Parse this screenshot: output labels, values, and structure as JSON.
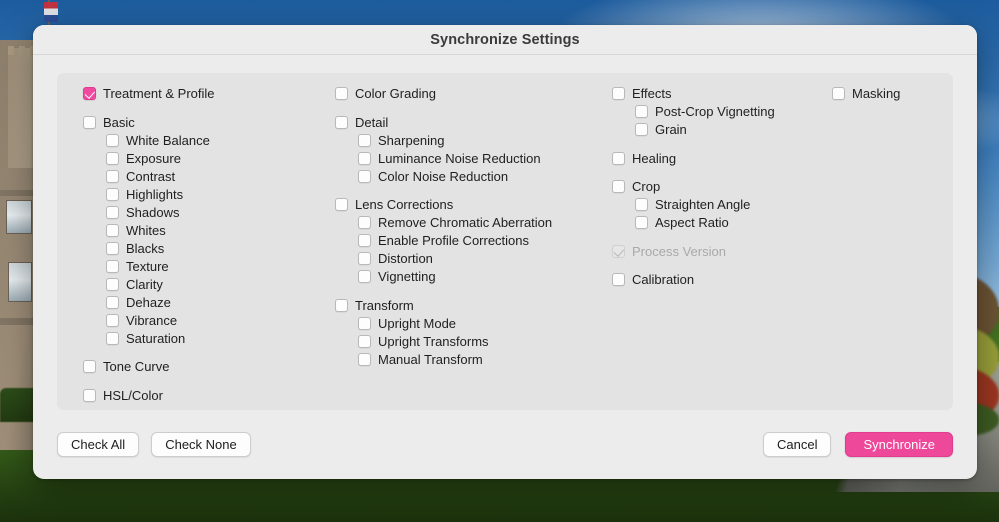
{
  "background": {
    "description": "castle-lawn-photo",
    "sky_color": "#3d80c0",
    "grass_color": "#4d7d26"
  },
  "dialog": {
    "title": "Synchronize Settings",
    "accent_color": "#ed4899"
  },
  "columns": [
    {
      "name": "column-1",
      "items": [
        {
          "label": "Treatment & Profile",
          "level": 0,
          "state": "checked",
          "gap": false
        },
        {
          "label": "Basic",
          "level": 0,
          "state": "unchecked",
          "gap": true
        },
        {
          "label": "White Balance",
          "level": 1,
          "state": "unchecked",
          "gap": false
        },
        {
          "label": "Exposure",
          "level": 1,
          "state": "unchecked",
          "gap": false
        },
        {
          "label": "Contrast",
          "level": 1,
          "state": "unchecked",
          "gap": false
        },
        {
          "label": "Highlights",
          "level": 1,
          "state": "unchecked",
          "gap": false
        },
        {
          "label": "Shadows",
          "level": 1,
          "state": "unchecked",
          "gap": false
        },
        {
          "label": "Whites",
          "level": 1,
          "state": "unchecked",
          "gap": false
        },
        {
          "label": "Blacks",
          "level": 1,
          "state": "unchecked",
          "gap": false
        },
        {
          "label": "Texture",
          "level": 1,
          "state": "unchecked",
          "gap": false
        },
        {
          "label": "Clarity",
          "level": 1,
          "state": "unchecked",
          "gap": false
        },
        {
          "label": "Dehaze",
          "level": 1,
          "state": "unchecked",
          "gap": false
        },
        {
          "label": "Vibrance",
          "level": 1,
          "state": "unchecked",
          "gap": false
        },
        {
          "label": "Saturation",
          "level": 1,
          "state": "unchecked",
          "gap": false
        },
        {
          "label": "Tone Curve",
          "level": 0,
          "state": "unchecked",
          "gap": true
        },
        {
          "label": "HSL/Color",
          "level": 0,
          "state": "unchecked",
          "gap": true
        }
      ]
    },
    {
      "name": "column-2",
      "items": [
        {
          "label": "Color Grading",
          "level": 0,
          "state": "unchecked",
          "gap": false
        },
        {
          "label": "Detail",
          "level": 0,
          "state": "unchecked",
          "gap": true
        },
        {
          "label": "Sharpening",
          "level": 1,
          "state": "unchecked",
          "gap": false
        },
        {
          "label": "Luminance Noise Reduction",
          "level": 1,
          "state": "unchecked",
          "gap": false
        },
        {
          "label": "Color Noise Reduction",
          "level": 1,
          "state": "unchecked",
          "gap": false
        },
        {
          "label": "Lens Corrections",
          "level": 0,
          "state": "unchecked",
          "gap": true
        },
        {
          "label": "Remove Chromatic Aberration",
          "level": 1,
          "state": "unchecked",
          "gap": false
        },
        {
          "label": "Enable Profile Corrections",
          "level": 1,
          "state": "unchecked",
          "gap": false
        },
        {
          "label": "Distortion",
          "level": 1,
          "state": "unchecked",
          "gap": false
        },
        {
          "label": "Vignetting",
          "level": 1,
          "state": "unchecked",
          "gap": false
        },
        {
          "label": "Transform",
          "level": 0,
          "state": "unchecked",
          "gap": true
        },
        {
          "label": "Upright Mode",
          "level": 1,
          "state": "unchecked",
          "gap": false
        },
        {
          "label": "Upright Transforms",
          "level": 1,
          "state": "unchecked",
          "gap": false
        },
        {
          "label": "Manual Transform",
          "level": 1,
          "state": "unchecked",
          "gap": false
        }
      ]
    },
    {
      "name": "column-3",
      "items": [
        {
          "label": "Effects",
          "level": 0,
          "state": "unchecked",
          "gap": false
        },
        {
          "label": "Post-Crop Vignetting",
          "level": 1,
          "state": "unchecked",
          "gap": false
        },
        {
          "label": "Grain",
          "level": 1,
          "state": "unchecked",
          "gap": false
        },
        {
          "label": "Healing",
          "level": 0,
          "state": "unchecked",
          "gap": true
        },
        {
          "label": "Crop",
          "level": 0,
          "state": "unchecked",
          "gap": true
        },
        {
          "label": "Straighten Angle",
          "level": 1,
          "state": "unchecked",
          "gap": false
        },
        {
          "label": "Aspect Ratio",
          "level": 1,
          "state": "unchecked",
          "gap": false
        },
        {
          "label": "Process Version",
          "level": 0,
          "state": "disabled-checked",
          "gap": true
        },
        {
          "label": "Calibration",
          "level": 0,
          "state": "unchecked",
          "gap": true
        }
      ]
    },
    {
      "name": "column-4",
      "items": [
        {
          "label": "Masking",
          "level": 0,
          "state": "unchecked",
          "gap": false
        }
      ]
    }
  ],
  "footer": {
    "check_all_label": "Check All",
    "check_none_label": "Check None",
    "cancel_label": "Cancel",
    "synchronize_label": "Synchronize"
  }
}
